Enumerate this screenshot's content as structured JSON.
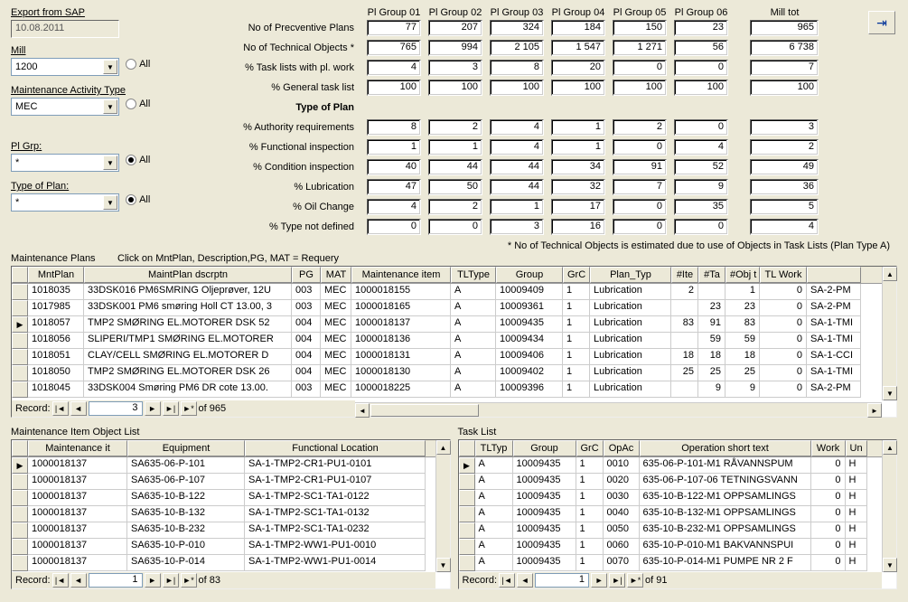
{
  "header": {
    "export_label": "Export from SAP",
    "export_date": "10.08.2011",
    "mill_label": "Mill",
    "mill_value": "1200",
    "mat_label": "Maintenance Activity Type",
    "mat_value": "MEC",
    "plgrp_label": "Pl Grp:",
    "plgrp_value": "*",
    "plantype_label": "Type of Plan:",
    "plantype_value": "*",
    "all_label": "All"
  },
  "exit_icon": "⇥",
  "stats": {
    "cols": [
      "Pl Group 01",
      "Pl Group 02",
      "Pl Group 03",
      "Pl Group 04",
      "Pl Group 05",
      "Pl Group 06"
    ],
    "total_col": "Mill tot",
    "rows": {
      "prev_plans": {
        "label": "No of Precventive Plans",
        "v": [
          "77",
          "207",
          "324",
          "184",
          "150",
          "23"
        ],
        "t": "965"
      },
      "tech_obj": {
        "label": "No of Technical Objects  *",
        "v": [
          "765",
          "994",
          "2 105",
          "1 547",
          "1 271",
          "56"
        ],
        "t": "6 738"
      },
      "tlwork": {
        "label": "% Task lists with pl. work",
        "v": [
          "4",
          "3",
          "8",
          "20",
          "0",
          "0"
        ],
        "t": "7"
      },
      "gentl": {
        "label": "% General task list",
        "v": [
          "100",
          "100",
          "100",
          "100",
          "100",
          "100"
        ],
        "t": "100"
      },
      "type_header": "Type of Plan",
      "auth": {
        "label": "% Authority requirements",
        "v": [
          "8",
          "2",
          "4",
          "1",
          "2",
          "0"
        ],
        "t": "3"
      },
      "func": {
        "label": "% Functional inspection",
        "v": [
          "1",
          "1",
          "4",
          "1",
          "0",
          "4"
        ],
        "t": "2"
      },
      "cond": {
        "label": "% Condition inspection",
        "v": [
          "40",
          "44",
          "44",
          "34",
          "91",
          "52"
        ],
        "t": "49"
      },
      "lub": {
        "label": "% Lubrication",
        "v": [
          "47",
          "50",
          "44",
          "32",
          "7",
          "9"
        ],
        "t": "36"
      },
      "oil": {
        "label": "% Oil Change",
        "v": [
          "4",
          "2",
          "1",
          "17",
          "0",
          "35"
        ],
        "t": "5"
      },
      "undef": {
        "label": "% Type not defined",
        "v": [
          "0",
          "0",
          "3",
          "16",
          "0",
          "0"
        ],
        "t": "4"
      }
    }
  },
  "footnote": "*  No of Technical Objects is estimated due to use of Objects in Task Lists (Plan Type A)",
  "plans": {
    "title": "Maintenance Plans",
    "hint": "Click on MntPlan, Description,PG, MAT = Requery",
    "cols": [
      "MntPlan",
      "MaintPlan dscrptn",
      "PG",
      "MAT",
      "Maintenance item",
      "TLType",
      "Group",
      "GrC",
      "Plan_Typ",
      "#Ite",
      "#Ta",
      "#Obj t",
      "TL Work",
      ""
    ],
    "rows": [
      {
        "sel": "",
        "c": [
          "1018035",
          "33DSK016 PM6SMRING Oljeprøver, 12U",
          "003",
          "MEC",
          "1000018155",
          "A",
          "10009409",
          "1",
          "Lubrication",
          "2",
          "",
          "1",
          "0",
          "SA-2-PM"
        ]
      },
      {
        "sel": "",
        "c": [
          "1017985",
          "33DSK001 PM6 smøring Holl CT 13.00, 3",
          "003",
          "MEC",
          "1000018165",
          "A",
          "10009361",
          "1",
          "Lubrication",
          "",
          "23",
          "23",
          "0",
          "SA-2-PM"
        ]
      },
      {
        "sel": "▶",
        "c": [
          "1018057",
          "TMP2 SMØRING EL.MOTORER DSK 52",
          "004",
          "MEC",
          "1000018137",
          "A",
          "10009435",
          "1",
          "Lubrication",
          "83",
          "91",
          "83",
          "0",
          "SA-1-TMI"
        ]
      },
      {
        "sel": "",
        "c": [
          "1018056",
          "SLIPERI/TMP1 SMØRING EL.MOTORER",
          "004",
          "MEC",
          "1000018136",
          "A",
          "10009434",
          "1",
          "Lubrication",
          "",
          "59",
          "59",
          "0",
          "SA-1-TMI"
        ]
      },
      {
        "sel": "",
        "c": [
          "1018051",
          "CLAY/CELL SMØRING EL.MOTORER D",
          "004",
          "MEC",
          "1000018131",
          "A",
          "10009406",
          "1",
          "Lubrication",
          "18",
          "18",
          "18",
          "0",
          "SA-1-CCI"
        ]
      },
      {
        "sel": "",
        "c": [
          "1018050",
          "TMP2 SMØRING EL.MOTORER DSK 26",
          "004",
          "MEC",
          "1000018130",
          "A",
          "10009402",
          "1",
          "Lubrication",
          "25",
          "25",
          "25",
          "0",
          "SA-1-TMI"
        ]
      },
      {
        "sel": "",
        "c": [
          "1018045",
          "33DSK004 Smøring PM6 DR cote 13.00.",
          "003",
          "MEC",
          "1000018225",
          "A",
          "10009396",
          "1",
          "Lubrication",
          "",
          "9",
          "9",
          "0",
          "SA-2-PM"
        ]
      }
    ],
    "rec_pos": "3",
    "rec_of": "of  965"
  },
  "objlist": {
    "title": "Maintenance Item Object List",
    "cols": [
      "Maintenance it",
      "Equipment",
      "Functional Location"
    ],
    "rows": [
      {
        "sel": "▶",
        "c": [
          "1000018137",
          "SA635-06-P-101",
          "SA-1-TMP2-CR1-PU1-0101"
        ]
      },
      {
        "sel": "",
        "c": [
          "1000018137",
          "SA635-06-P-107",
          "SA-1-TMP2-CR1-PU1-0107"
        ]
      },
      {
        "sel": "",
        "c": [
          "1000018137",
          "SA635-10-B-122",
          "SA-1-TMP2-SC1-TA1-0122"
        ]
      },
      {
        "sel": "",
        "c": [
          "1000018137",
          "SA635-10-B-132",
          "SA-1-TMP2-SC1-TA1-0132"
        ]
      },
      {
        "sel": "",
        "c": [
          "1000018137",
          "SA635-10-B-232",
          "SA-1-TMP2-SC1-TA1-0232"
        ]
      },
      {
        "sel": "",
        "c": [
          "1000018137",
          "SA635-10-P-010",
          "SA-1-TMP2-WW1-PU1-0010"
        ]
      },
      {
        "sel": "",
        "c": [
          "1000018137",
          "SA635-10-P-014",
          "SA-1-TMP2-WW1-PU1-0014"
        ]
      }
    ],
    "rec_pos": "1",
    "rec_of": "of  83"
  },
  "tasklist": {
    "title": "Task List",
    "cols": [
      "TLTyp",
      "Group",
      "GrC",
      "OpAc",
      "Operation short text",
      "Work",
      "Un"
    ],
    "rows": [
      {
        "sel": "▶",
        "c": [
          "A",
          "10009435",
          "1",
          "0010",
          "635-06-P-101-M1 RÅVANNSPUM",
          "0",
          "H"
        ]
      },
      {
        "sel": "",
        "c": [
          "A",
          "10009435",
          "1",
          "0020",
          "635-06-P-107-06 TETNINGSVANN",
          "0",
          "H"
        ]
      },
      {
        "sel": "",
        "c": [
          "A",
          "10009435",
          "1",
          "0030",
          "635-10-B-122-M1 OPPSAMLINGS",
          "0",
          "H"
        ]
      },
      {
        "sel": "",
        "c": [
          "A",
          "10009435",
          "1",
          "0040",
          "635-10-B-132-M1 OPPSAMLINGS",
          "0",
          "H"
        ]
      },
      {
        "sel": "",
        "c": [
          "A",
          "10009435",
          "1",
          "0050",
          "635-10-B-232-M1 OPPSAMLINGS",
          "0",
          "H"
        ]
      },
      {
        "sel": "",
        "c": [
          "A",
          "10009435",
          "1",
          "0060",
          "635-10-P-010-M1 BAKVANNSPUI",
          "0",
          "H"
        ]
      },
      {
        "sel": "",
        "c": [
          "A",
          "10009435",
          "1",
          "0070",
          "635-10-P-014-M1 PUMPE NR 2 F",
          "0",
          "H"
        ]
      }
    ],
    "rec_pos": "1",
    "rec_of": "of  91"
  },
  "nav": {
    "first": "|◄",
    "prev": "◄",
    "next": "►",
    "last": "►|",
    "new": "►*",
    "record": "Record:"
  }
}
